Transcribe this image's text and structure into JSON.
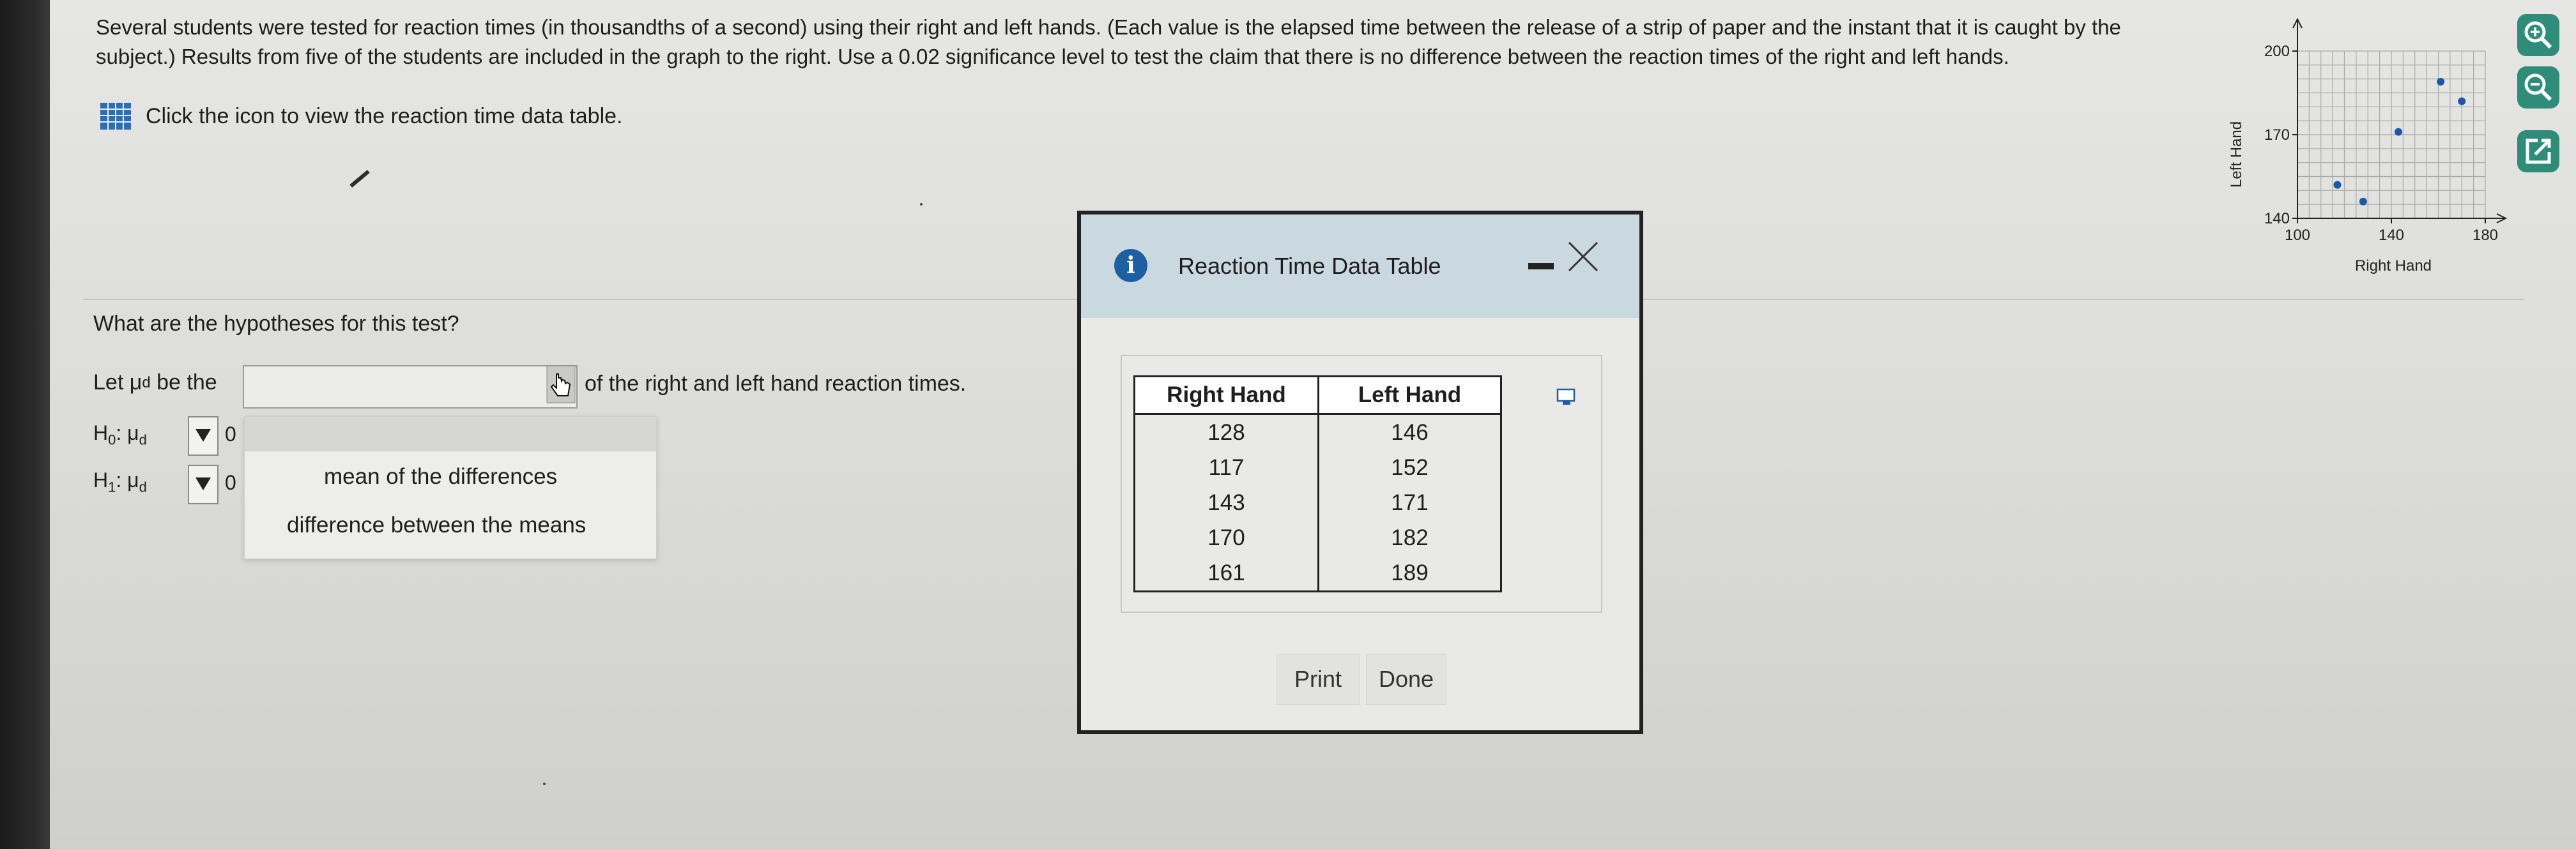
{
  "question": {
    "text": "Several students were tested for reaction times (in thousandths of a second) using their right and left hands. (Each value is the elapsed time between the release of a strip of paper and the instant that it is caught by the subject.) Results from five of the students are included in the graph to the right. Use a 0.02 significance level to test the claim that there is no difference between the reaction times of the right and left hands."
  },
  "data_link": {
    "label": "Click the icon to view the reaction time data table.",
    "icon": "table-grid-icon"
  },
  "hypotheses": {
    "prompt": "What are the hypotheses for this test?",
    "let_prefix": "Let μ",
    "let_sub": "d",
    "let_middle": " be the",
    "let_suffix": "of the right and left hand reaction times.",
    "h0_label": "H",
    "h0_sub": "0",
    "h1_label": "H",
    "h1_sub": "1",
    "mu_label": ": μ",
    "mu_sub": "d",
    "h0_value": "0",
    "h1_value": "0",
    "dropdown_options": [
      "mean of the differences",
      "difference between the means"
    ]
  },
  "dialog": {
    "title": "Reaction Time Data Table",
    "columns": [
      "Right Hand",
      "Left Hand"
    ],
    "rows": [
      [
        "128",
        "146"
      ],
      [
        "117",
        "152"
      ],
      [
        "143",
        "171"
      ],
      [
        "170",
        "182"
      ],
      [
        "161",
        "189"
      ]
    ],
    "print_label": "Print",
    "done_label": "Done"
  },
  "tools": [
    "zoom-in-icon",
    "zoom-out-icon",
    "open-external-icon"
  ],
  "chart_data": {
    "type": "scatter",
    "xlabel": "Right Hand",
    "ylabel": "Left Hand",
    "x_ticks": [
      "100",
      "140",
      "180"
    ],
    "y_ticks": [
      "140",
      "170",
      "200"
    ],
    "xlim": [
      100,
      180
    ],
    "ylim": [
      140,
      200
    ],
    "grid": true,
    "points": [
      {
        "x": 128,
        "y": 146
      },
      {
        "x": 117,
        "y": 152
      },
      {
        "x": 143,
        "y": 171
      },
      {
        "x": 170,
        "y": 182
      },
      {
        "x": 161,
        "y": 189
      }
    ],
    "point_color": "#1f57a8"
  }
}
